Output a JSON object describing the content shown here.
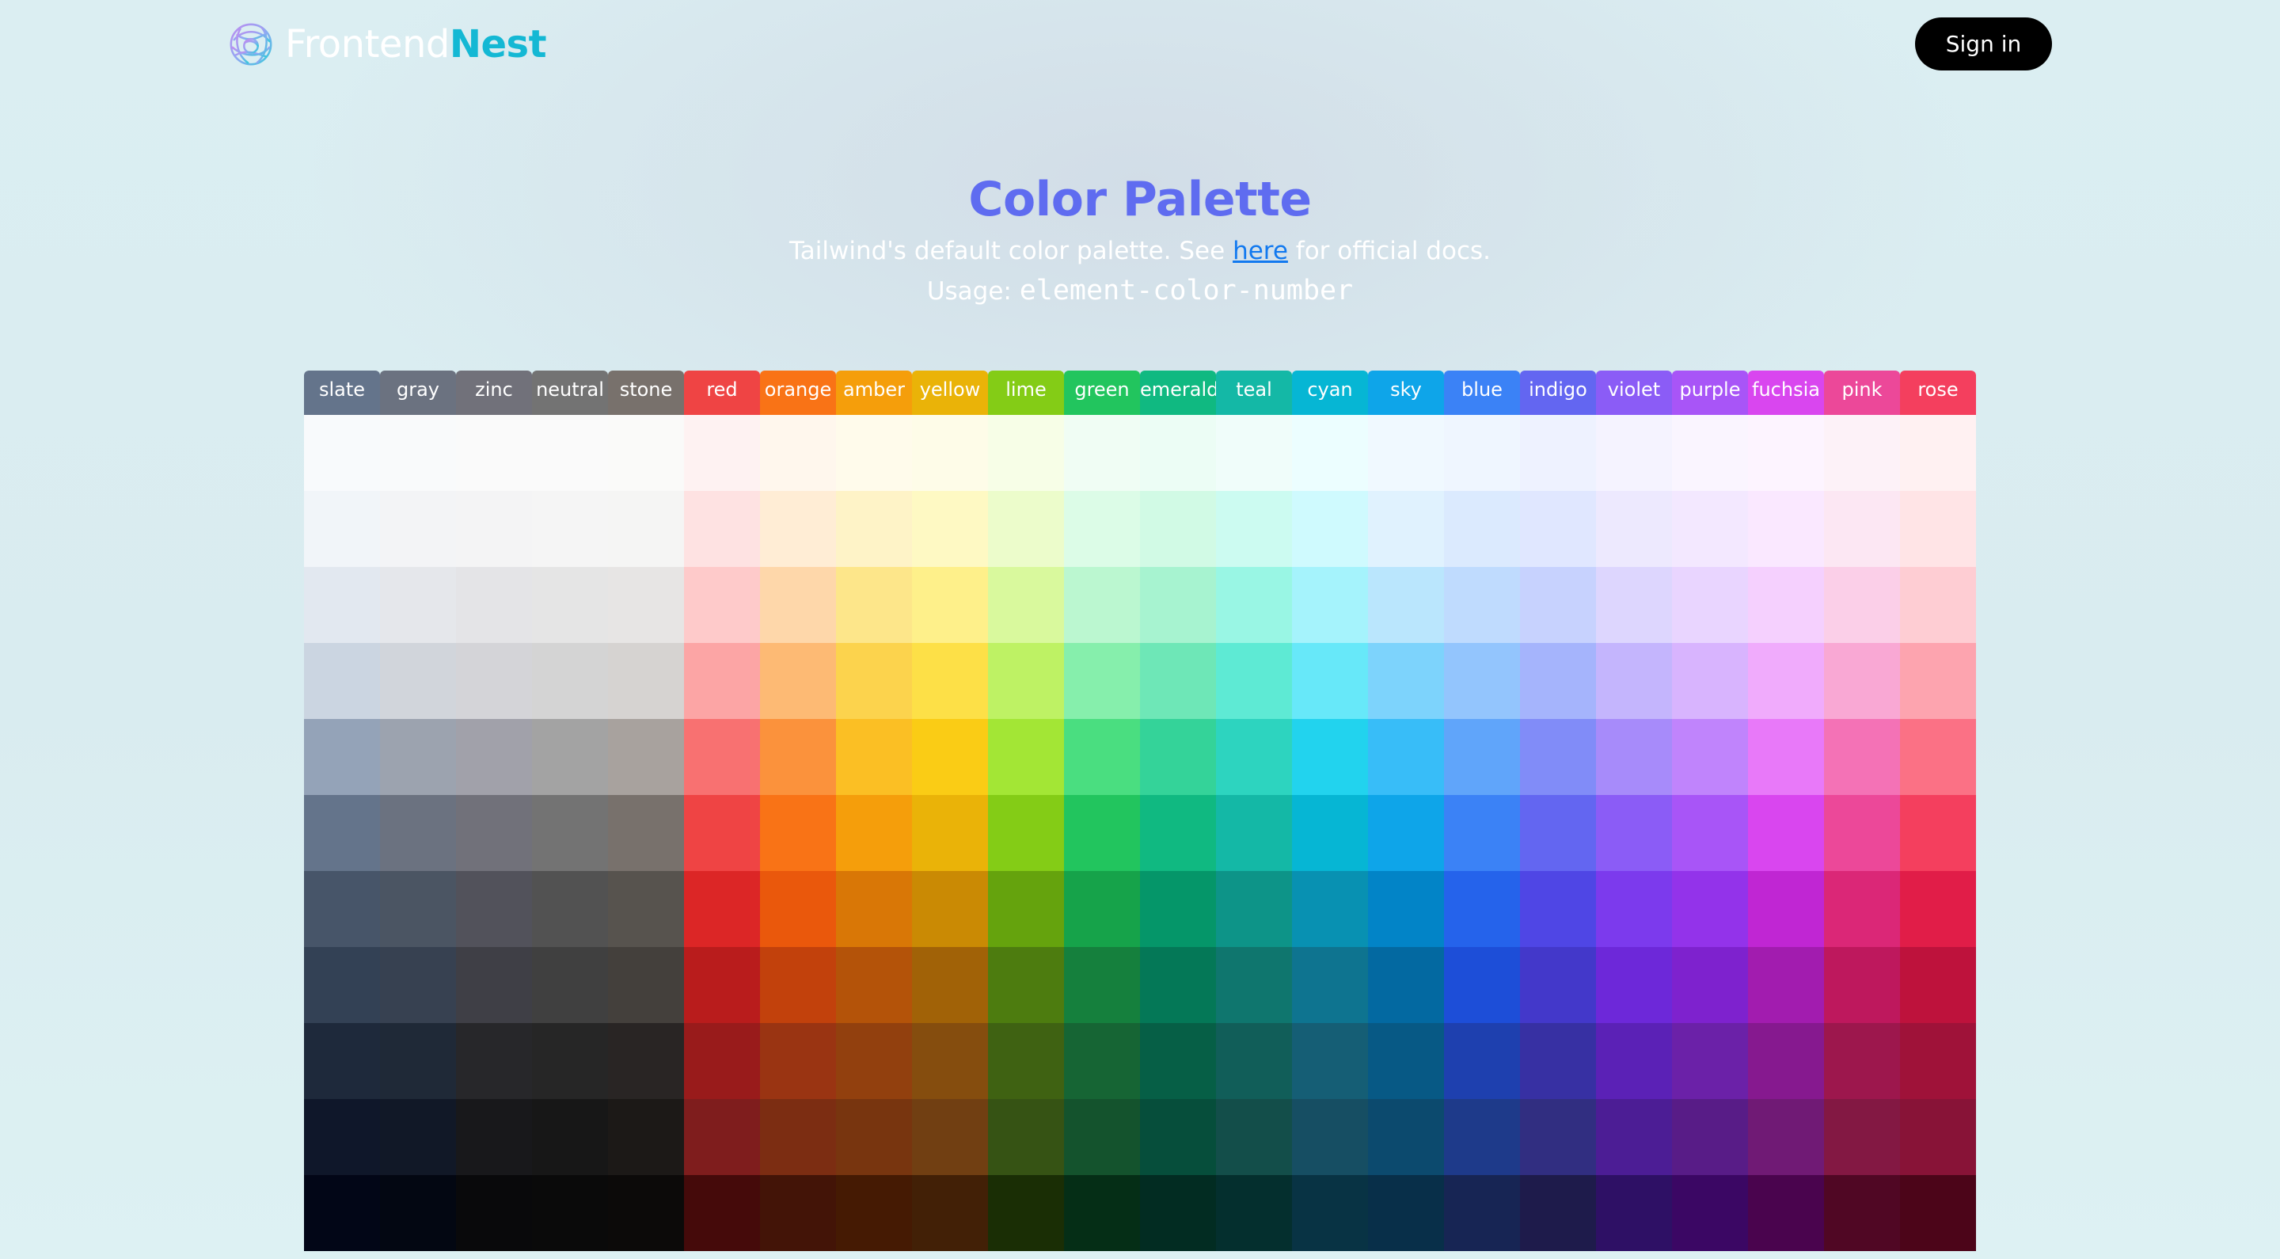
{
  "header": {
    "brand_part1": "Frontend",
    "brand_part2": "Nest",
    "sign_in_label": "Sign in"
  },
  "hero": {
    "title": "Color Palette",
    "subtitle_before": "Tailwind's default color palette. See ",
    "subtitle_link": "here",
    "subtitle_after": " for official docs.",
    "usage_label": "Usage: ",
    "usage_code": "element-color-number"
  },
  "colors": {
    "brand_accent": "#14b8d4",
    "title": "#5f6cf0",
    "link": "#1279ef",
    "button_bg": "#000000"
  },
  "palette": {
    "columns": [
      {
        "name": "slate",
        "header_color": "#64748b",
        "shades": [
          "#f8fafc",
          "#f1f5f9",
          "#e2e8f0",
          "#cbd5e1",
          "#94a3b8",
          "#64748b",
          "#475569",
          "#334155",
          "#1e293b",
          "#0f172a",
          "#020617"
        ]
      },
      {
        "name": "gray",
        "header_color": "#6b7280",
        "shades": [
          "#f9fafb",
          "#f3f4f6",
          "#e5e7eb",
          "#d1d5db",
          "#9ca3af",
          "#6b7280",
          "#4b5563",
          "#374151",
          "#1f2937",
          "#111827",
          "#030712"
        ]
      },
      {
        "name": "zinc",
        "header_color": "#71717a",
        "shades": [
          "#fafafa",
          "#f4f4f5",
          "#e4e4e7",
          "#d4d4d8",
          "#a1a1aa",
          "#71717a",
          "#52525b",
          "#3f3f46",
          "#27272a",
          "#18181b",
          "#09090b"
        ]
      },
      {
        "name": "neutral",
        "header_color": "#737373",
        "shades": [
          "#fafafa",
          "#f5f5f5",
          "#e5e5e5",
          "#d4d4d4",
          "#a3a3a3",
          "#737373",
          "#525252",
          "#404040",
          "#262626",
          "#171717",
          "#0a0a0a"
        ]
      },
      {
        "name": "stone",
        "header_color": "#78716c",
        "shades": [
          "#fafaf9",
          "#f5f5f4",
          "#e7e5e4",
          "#d6d3d1",
          "#a8a29e",
          "#78716c",
          "#57534e",
          "#44403c",
          "#292524",
          "#1c1917",
          "#0c0a09"
        ]
      },
      {
        "name": "red",
        "header_color": "#ef4444",
        "shades": [
          "#fef2f2",
          "#fee2e2",
          "#fecaca",
          "#fca5a5",
          "#f87171",
          "#ef4444",
          "#dc2626",
          "#b91c1c",
          "#991b1b",
          "#7f1d1d",
          "#450a0a"
        ]
      },
      {
        "name": "orange",
        "header_color": "#f97316",
        "shades": [
          "#fff7ed",
          "#ffedd5",
          "#fed7aa",
          "#fdba74",
          "#fb923c",
          "#f97316",
          "#ea580c",
          "#c2410c",
          "#9a3412",
          "#7c2d12",
          "#431407"
        ]
      },
      {
        "name": "amber",
        "header_color": "#f59e0b",
        "shades": [
          "#fffbeb",
          "#fef3c7",
          "#fde68a",
          "#fcd34d",
          "#fbbf24",
          "#f59e0b",
          "#d97706",
          "#b45309",
          "#92400e",
          "#78350f",
          "#451a03"
        ]
      },
      {
        "name": "yellow",
        "header_color": "#eab308",
        "shades": [
          "#fefce8",
          "#fef9c3",
          "#fef08a",
          "#fde047",
          "#facc15",
          "#eab308",
          "#ca8a04",
          "#a16207",
          "#854d0e",
          "#713f12",
          "#422006"
        ]
      },
      {
        "name": "lime",
        "header_color": "#84cc16",
        "shades": [
          "#f7fee7",
          "#ecfccb",
          "#d9f99d",
          "#bef264",
          "#a3e635",
          "#84cc16",
          "#65a30d",
          "#4d7c0f",
          "#3f6212",
          "#365314",
          "#1a2e05"
        ]
      },
      {
        "name": "green",
        "header_color": "#22c55e",
        "shades": [
          "#f0fdf4",
          "#dcfce7",
          "#bbf7d0",
          "#86efac",
          "#4ade80",
          "#22c55e",
          "#16a34a",
          "#15803d",
          "#166534",
          "#14532d",
          "#052e16"
        ]
      },
      {
        "name": "emerald",
        "header_color": "#10b981",
        "shades": [
          "#ecfdf5",
          "#d1fae5",
          "#a7f3d0",
          "#6ee7b7",
          "#34d399",
          "#10b981",
          "#059669",
          "#047857",
          "#065f46",
          "#064e3b",
          "#022c22"
        ]
      },
      {
        "name": "teal",
        "header_color": "#14b8a6",
        "shades": [
          "#f0fdfa",
          "#ccfbf1",
          "#99f6e4",
          "#5eead4",
          "#2dd4bf",
          "#14b8a6",
          "#0d9488",
          "#0f766e",
          "#115e59",
          "#134e4a",
          "#042f2e"
        ]
      },
      {
        "name": "cyan",
        "header_color": "#06b6d4",
        "shades": [
          "#ecfeff",
          "#cffafe",
          "#a5f3fc",
          "#67e8f9",
          "#22d3ee",
          "#06b6d4",
          "#0891b2",
          "#0e7490",
          "#155e75",
          "#164e63",
          "#083344"
        ]
      },
      {
        "name": "sky",
        "header_color": "#0ea5e9",
        "shades": [
          "#f0f9ff",
          "#e0f2fe",
          "#bae6fd",
          "#7dd3fc",
          "#38bdf8",
          "#0ea5e9",
          "#0284c7",
          "#0369a1",
          "#075985",
          "#0c4a6e",
          "#082f49"
        ]
      },
      {
        "name": "blue",
        "header_color": "#3b82f6",
        "shades": [
          "#eff6ff",
          "#dbeafe",
          "#bfdbfe",
          "#93c5fd",
          "#60a5fa",
          "#3b82f6",
          "#2563eb",
          "#1d4ed8",
          "#1e40af",
          "#1e3a8a",
          "#172554"
        ]
      },
      {
        "name": "indigo",
        "header_color": "#6366f1",
        "shades": [
          "#eef2ff",
          "#e0e7ff",
          "#c7d2fe",
          "#a5b4fc",
          "#818cf8",
          "#6366f1",
          "#4f46e5",
          "#4338ca",
          "#3730a3",
          "#312e81",
          "#1e1b4b"
        ]
      },
      {
        "name": "violet",
        "header_color": "#8b5cf6",
        "shades": [
          "#f5f3ff",
          "#ede9fe",
          "#ddd6fe",
          "#c4b5fd",
          "#a78bfa",
          "#8b5cf6",
          "#7c3aed",
          "#6d28d9",
          "#5b21b6",
          "#4c1d95",
          "#2e1065"
        ]
      },
      {
        "name": "purple",
        "header_color": "#a855f7",
        "shades": [
          "#faf5ff",
          "#f3e8ff",
          "#e9d5ff",
          "#d8b4fe",
          "#c084fc",
          "#a855f7",
          "#9333ea",
          "#7e22ce",
          "#6b21a8",
          "#581c87",
          "#3b0764"
        ]
      },
      {
        "name": "fuchsia",
        "header_color": "#d946ef",
        "shades": [
          "#fdf4ff",
          "#fae8ff",
          "#f5d0fe",
          "#f0abfc",
          "#e879f9",
          "#d946ef",
          "#c026d3",
          "#a21caf",
          "#86198f",
          "#701a75",
          "#4a044e"
        ]
      },
      {
        "name": "pink",
        "header_color": "#ec4899",
        "shades": [
          "#fdf2f8",
          "#fce7f3",
          "#fbcfe8",
          "#f9a8d4",
          "#f472b6",
          "#ec4899",
          "#db2777",
          "#be185d",
          "#9d174d",
          "#831843",
          "#500724"
        ]
      },
      {
        "name": "rose",
        "header_color": "#f43f5e",
        "shades": [
          "#fff1f2",
          "#ffe4e6",
          "#fecdd3",
          "#fda4af",
          "#fb7185",
          "#f43f5e",
          "#e11d48",
          "#be123c",
          "#9f1239",
          "#881337",
          "#4c0519"
        ]
      }
    ]
  }
}
